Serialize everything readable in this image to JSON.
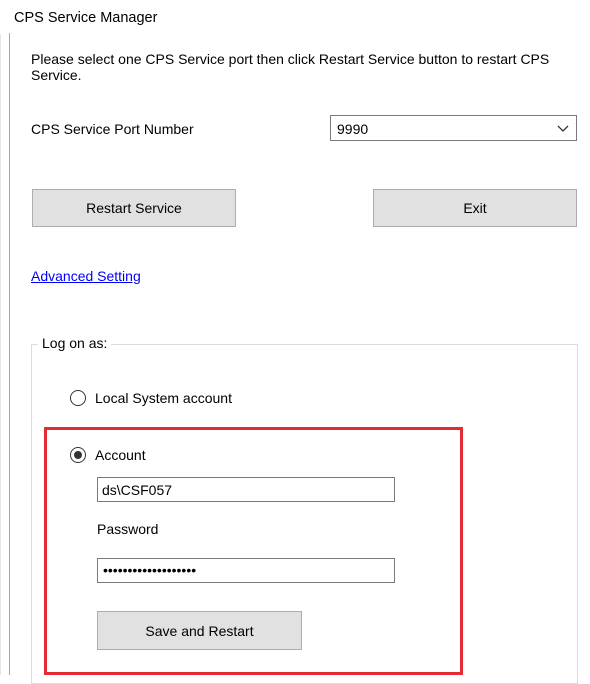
{
  "window": {
    "title": "CPS Service Manager"
  },
  "dialog": {
    "instruction": "Please select one CPS Service port then click Restart Service button to restart CPS Service.",
    "port_label": "CPS Service Port Number",
    "port_value": "9990",
    "restart_button": "Restart Service",
    "exit_button": "Exit",
    "advanced_link": "Advanced Setting"
  },
  "logon": {
    "legend": "Log on as:",
    "local_system_label": "Local System account",
    "local_system_selected": false,
    "account_label": "Account",
    "account_selected": true,
    "account_value": "ds\\CSF057",
    "password_label": "Password",
    "password_mask": "•••••••••••••••••••",
    "save_button": "Save and Restart"
  },
  "colors": {
    "highlight_border": "#e32b33",
    "link": "#0000ff",
    "button_face": "#e1e1e1"
  },
  "icons": {
    "dropdown": "chevron-down-icon"
  }
}
